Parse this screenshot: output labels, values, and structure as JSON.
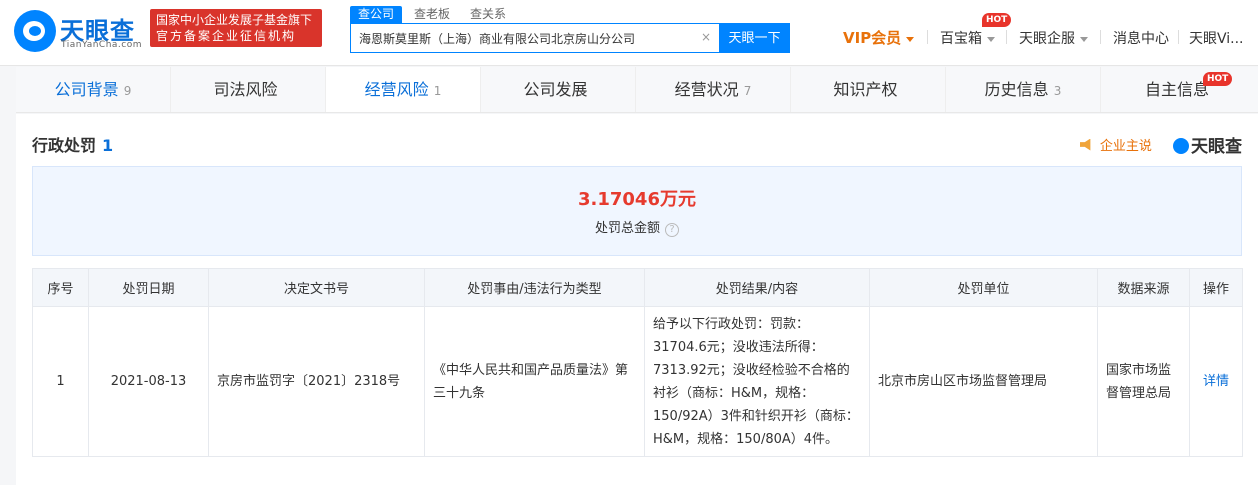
{
  "header": {
    "logo_text": "天眼查",
    "logo_sub": "TianYanCha.com",
    "badge_line1": "国家中小企业发展子基金旗下",
    "badge_line2": "官方备案企业征信机构",
    "search_tabs": [
      "查公司",
      "查老板",
      "查关系"
    ],
    "search_value": "海恩斯莫里斯（上海）商业有限公司北京房山分公司",
    "search_clear": "×",
    "search_button": "天眼一下",
    "nav": {
      "vip": "VIP会员",
      "treasure": "百宝箱",
      "hot": "HOT",
      "enterprise": "天眼企服",
      "messages": "消息中心",
      "user": "天眼Vi..."
    }
  },
  "tabs": [
    {
      "label": "公司背景",
      "count": "9"
    },
    {
      "label": "司法风险",
      "count": ""
    },
    {
      "label": "经营风险",
      "count": "1"
    },
    {
      "label": "公司发展",
      "count": ""
    },
    {
      "label": "经营状况",
      "count": "7"
    },
    {
      "label": "知识产权",
      "count": ""
    },
    {
      "label": "历史信息",
      "count": "3"
    },
    {
      "label": "自主信息",
      "count": ""
    }
  ],
  "tab_hot": "HOT",
  "section": {
    "title": "行政处罚",
    "count": "1",
    "say_label": "企业主说",
    "brand": "天眼查"
  },
  "summary": {
    "amount": "3.17046万元",
    "label": "处罚总金额",
    "help": "?"
  },
  "table": {
    "headers": [
      "序号",
      "处罚日期",
      "决定文书号",
      "处罚事由/违法行为类型",
      "处罚结果/内容",
      "处罚单位",
      "数据来源",
      "操作"
    ],
    "rows": [
      {
        "index": "1",
        "date": "2021-08-13",
        "doc_no": "京房市监罚字〔2021〕2318号",
        "reason": "《中华人民共和国产品质量法》第三十九条",
        "result": "给予以下行政处罚：罚款：31704.6元；没收违法所得：7313.92元；没收经检验不合格的衬衫（商标：H&M，规格：150/92A）3件和针织开衫（商标：H&M，规格：150/80A）4件。",
        "unit": "北京市房山区市场监督管理局",
        "source": "国家市场监督管理总局",
        "action": "详情"
      }
    ]
  }
}
